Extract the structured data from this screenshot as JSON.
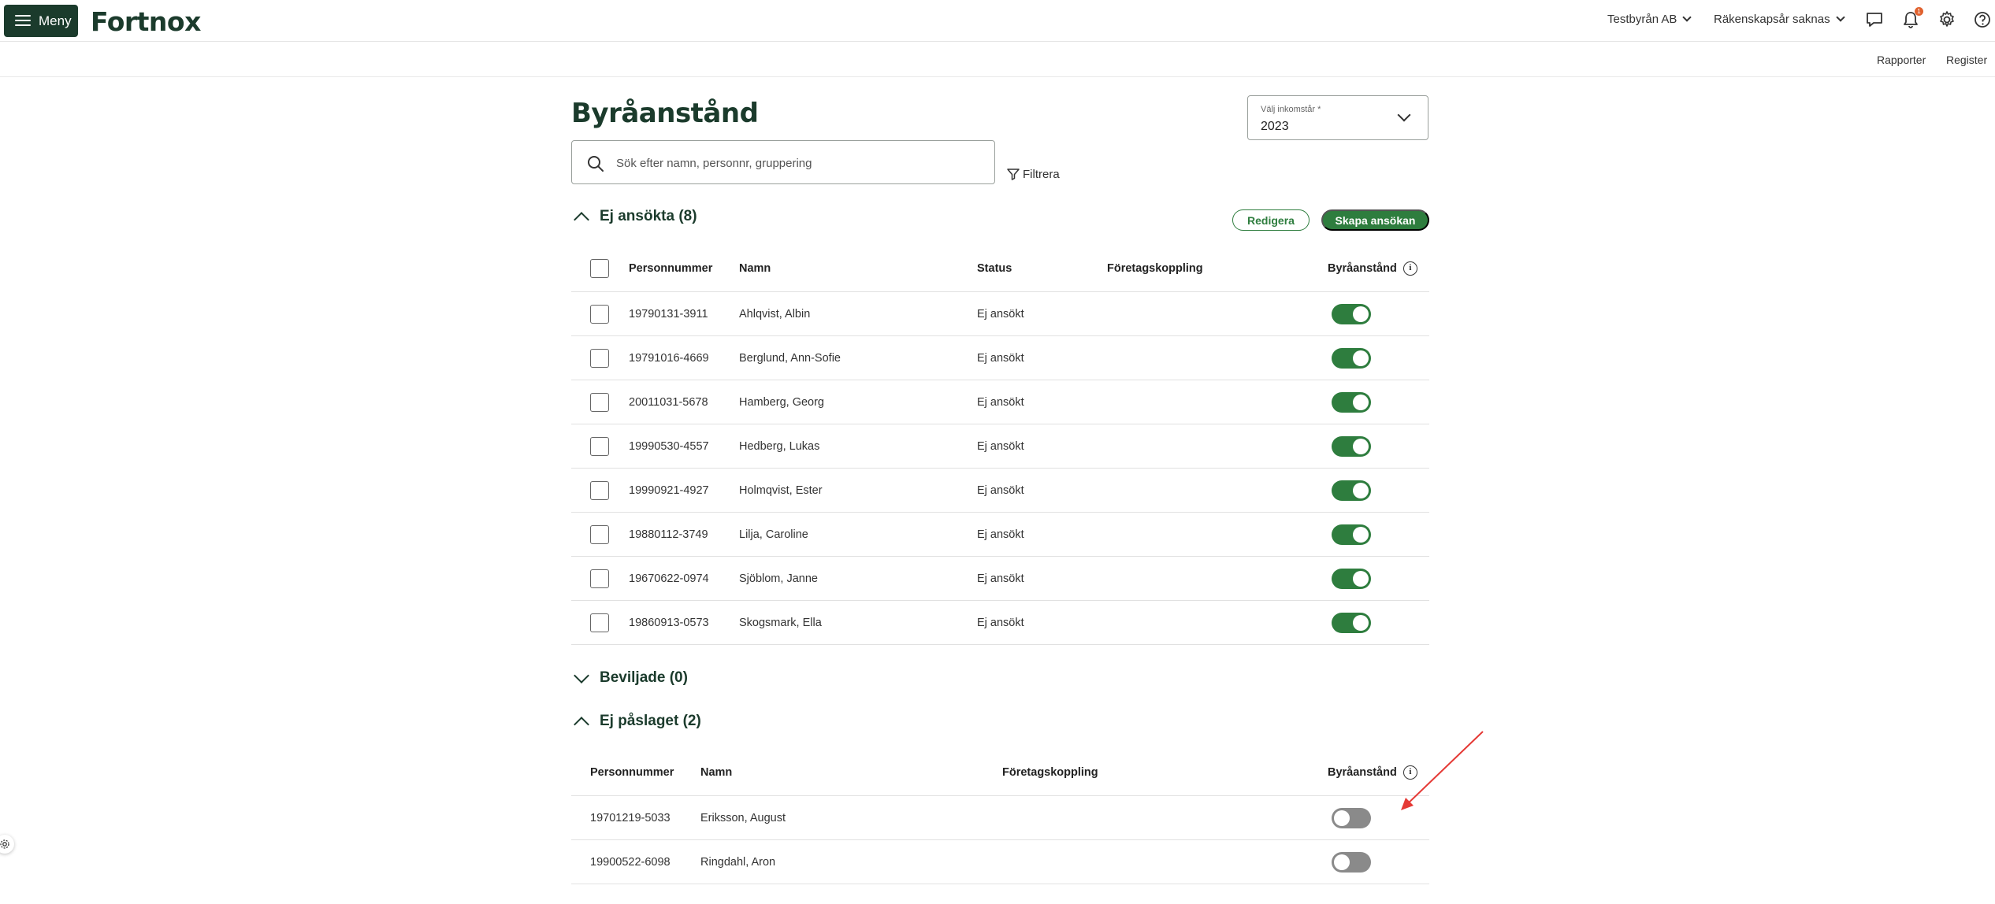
{
  "header": {
    "menu_label": "Meny",
    "logo": "Fortnox",
    "company": "Testbyrån AB",
    "fiscal_year": "Räkenskapsår saknas",
    "notification_count": "1",
    "icons": [
      "chat-icon",
      "bell-icon",
      "gear-icon",
      "help-icon"
    ]
  },
  "subnav": {
    "items": [
      "Rapporter",
      "Register"
    ]
  },
  "page": {
    "title": "Byråanstånd",
    "year_select": {
      "label": "Välj inkomstår *",
      "value": "2023"
    },
    "search": {
      "placeholder": "Sök efter namn, personnr, gruppering",
      "value": ""
    },
    "filter_label": "Filtrera"
  },
  "sections": {
    "not_applied": {
      "title": "Ej ansökta (8)",
      "edit_label": "Redigera",
      "create_label": "Skapa ansökan",
      "columns": [
        "Personnummer",
        "Namn",
        "Status",
        "Företagskoppling",
        "Byråanstånd"
      ],
      "rows": [
        {
          "pnr": "19790131-3911",
          "name": "Ahlqvist, Albin",
          "status": "Ej ansökt",
          "company": "",
          "toggle": true
        },
        {
          "pnr": "19791016-4669",
          "name": "Berglund, Ann-Sofie",
          "status": "Ej ansökt",
          "company": "",
          "toggle": true
        },
        {
          "pnr": "20011031-5678",
          "name": "Hamberg, Georg",
          "status": "Ej ansökt",
          "company": "",
          "toggle": true
        },
        {
          "pnr": "19990530-4557",
          "name": "Hedberg, Lukas",
          "status": "Ej ansökt",
          "company": "",
          "toggle": true
        },
        {
          "pnr": "19990921-4927",
          "name": "Holmqvist, Ester",
          "status": "Ej ansökt",
          "company": "",
          "toggle": true
        },
        {
          "pnr": "19880112-3749",
          "name": "Lilja, Caroline",
          "status": "Ej ansökt",
          "company": "",
          "toggle": true
        },
        {
          "pnr": "19670622-0974",
          "name": "Sjöblom, Janne",
          "status": "Ej ansökt",
          "company": "",
          "toggle": true
        },
        {
          "pnr": "19860913-0573",
          "name": "Skogsmark, Ella",
          "status": "Ej ansökt",
          "company": "",
          "toggle": true
        }
      ]
    },
    "granted": {
      "title": "Beviljade (0)"
    },
    "not_added": {
      "title": "Ej påslaget (2)",
      "columns": [
        "Personnummer",
        "Namn",
        "Företagskoppling",
        "Byråanstånd"
      ],
      "rows": [
        {
          "pnr": "19701219-5033",
          "name": "Eriksson, August",
          "company": "",
          "toggle": false
        },
        {
          "pnr": "19900522-6098",
          "name": "Ringdahl, Aron",
          "company": "",
          "toggle": false
        }
      ]
    }
  },
  "colors": {
    "brand_dark": "#1b3b2c",
    "brand_green": "#2e7d3e",
    "toggle_off": "#8a8a8a",
    "annotation_arrow": "#e53935"
  }
}
